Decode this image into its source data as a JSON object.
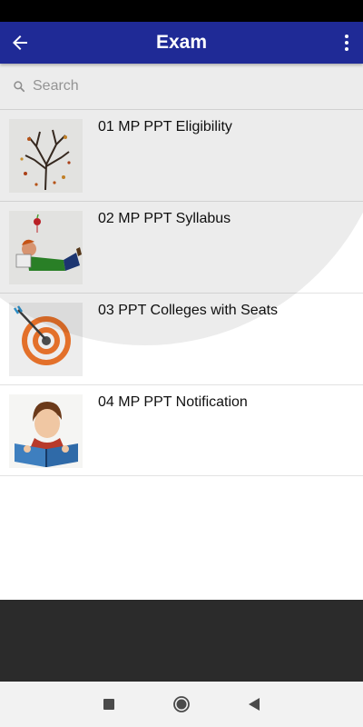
{
  "header": {
    "title": "Exam",
    "back_icon": "arrow-left-icon",
    "menu_icon": "more-vert-icon"
  },
  "search": {
    "placeholder": "Search",
    "value": "",
    "icon": "search-icon"
  },
  "items": [
    {
      "label": "01 MP PPT Eligibility",
      "thumbnail": "autumn-tree"
    },
    {
      "label": "02 MP PPT Syllabus",
      "thumbnail": "student-reading-with-apple"
    },
    {
      "label": "03 PPT Colleges with Seats",
      "thumbnail": "target-with-arrow"
    },
    {
      "label": "04 MP PPT Notification",
      "thumbnail": "man-reading-book"
    }
  ],
  "colors": {
    "app_bar": "#1f2a96",
    "footer": "#2b2b2b",
    "nav_bar": "#f2f2f2"
  },
  "nav": {
    "icons": [
      "recent-apps-icon",
      "home-icon",
      "back-triangle-icon"
    ]
  }
}
